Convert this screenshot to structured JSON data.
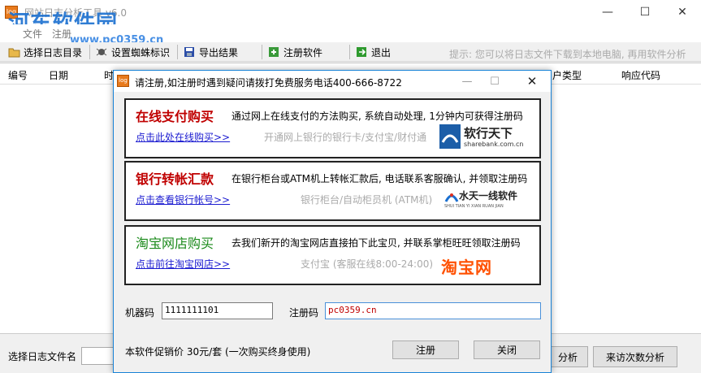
{
  "main": {
    "title": "网站日志分析工具 v6.0",
    "menu": [
      "文件",
      "注册"
    ],
    "toolbar": {
      "select_dir": "选择日志目录",
      "set_spider": "设置蜘蛛标识",
      "export": "导出结果",
      "register": "注册软件",
      "exit": "退出",
      "hint": "提示: 您可以将日志文件下载到本地电脑, 再用软件分析"
    },
    "columns": [
      "编号",
      "日期",
      "时",
      "户类型",
      "响应代码"
    ],
    "status": {
      "file_label": "选择日志文件名",
      "analyze_btn": "分析",
      "visits_btn": "来访次数分析"
    }
  },
  "watermark": {
    "text": "河东软件园",
    "url": "www.pc0359.cn"
  },
  "dialog": {
    "title": "请注册,如注册时遇到疑问请拨打免费服务电话400-666-8722",
    "panels": [
      {
        "title": "在线支付购买",
        "desc": "通过网上在线支付的方法购买, 系统自动处理, 1分钟内可获得注册码",
        "link": "点击此处在线购买>>",
        "sub": "开通网上银行的银行卡/支付宝/财付通",
        "logo": "软行天下",
        "logo_sub": "sharebank.com.cn",
        "title_color": "#c00000"
      },
      {
        "title": "银行转帐汇款",
        "desc": "在银行柜台或ATM机上转帐汇款后, 电话联系客服确认, 并领取注册码",
        "link": "点击查看银行帐号>>",
        "sub": "银行柜台/自动柜员机 (ATM机)",
        "logo": "水天一线软件",
        "logo_sub": "SHUI TIAN YI XIAN RUAN JIAN",
        "title_color": "#c00000"
      },
      {
        "title": "淘宝网店购买",
        "desc": "去我们新开的淘宝网店直接拍下此宝贝, 并联系掌柜旺旺领取注册码",
        "link": "点击前往淘宝网店>>",
        "sub": "支付宝 (客服在线8:00-24:00)",
        "logo": "淘宝网",
        "title_color": "#1a8a1a"
      }
    ],
    "machine_code_label": "机器码",
    "machine_code_value": "1111111101",
    "reg_code_label": "注册码",
    "reg_code_value": "pc0359.cn",
    "price_text": "本软件促销价 30元/套 (一次购买终身使用)",
    "register_btn": "注册",
    "close_btn": "关闭"
  }
}
